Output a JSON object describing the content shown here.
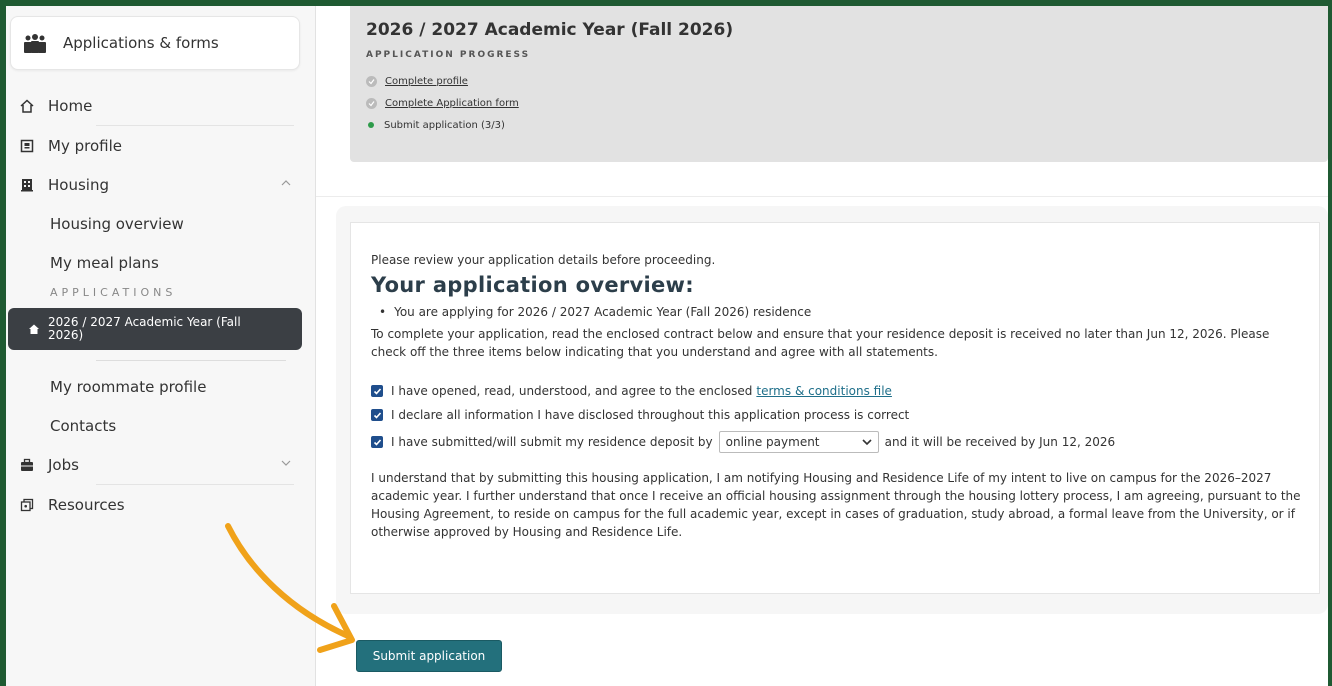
{
  "sidebar": {
    "app_title": "Applications & forms",
    "nav": {
      "home": "Home",
      "my_profile": "My profile",
      "housing": "Housing",
      "housing_overview": "Housing overview",
      "my_meal_plans": "My meal plans",
      "applications_label": "APPLICATIONS",
      "active_application": "2026 / 2027 Academic Year (Fall 2026)",
      "my_roommate_profile": "My roommate profile",
      "contacts": "Contacts",
      "jobs": "Jobs",
      "resources": "Resources"
    }
  },
  "progress": {
    "title": "2026 / 2027 Academic Year (Fall 2026)",
    "label": "APPLICATION PROGRESS",
    "steps": [
      {
        "label": "Complete profile"
      },
      {
        "label": "Complete Application form"
      },
      {
        "label": "Submit application (3/3)"
      }
    ]
  },
  "overview": {
    "intro": "Please review your application details before proceeding.",
    "heading": "Your application overview:",
    "bullet": "You are applying for 2026 / 2027 Academic Year (Fall 2026) residence",
    "instructions": "To complete your application, read the enclosed contract below and ensure that your residence deposit is received no later than Jun 12, 2026. Please check off the three items below indicating that you understand and agree with all statements.",
    "check1_text": "I have opened, read, understood, and agree to the enclosed",
    "check1_link": "terms & conditions file",
    "check2_text": "I declare all information I have disclosed throughout this application process is correct",
    "check3_pre": "I have submitted/will submit my residence deposit by",
    "payment_method": "online payment",
    "check3_post": "and it will be received by Jun 12, 2026",
    "statement": "I understand that by submitting this housing application, I am notifying Housing and Residence Life of my intent to live on campus for the 2026–2027 academic year. I further understand that once I receive an official housing assignment through the housing lottery process, I am agreeing, pursuant to the Housing Agreement, to reside on campus for the full academic year, except in cases of graduation, study abroad, a formal leave from the University, or if otherwise approved by Housing and Residence Life."
  },
  "submit_label": "Submit application",
  "colors": {
    "frame": "#1f5a32",
    "active_nav": "#3b3f44",
    "submit": "#23707c",
    "arrow": "#f0a21a",
    "progress_active": "#2e9b4a"
  }
}
